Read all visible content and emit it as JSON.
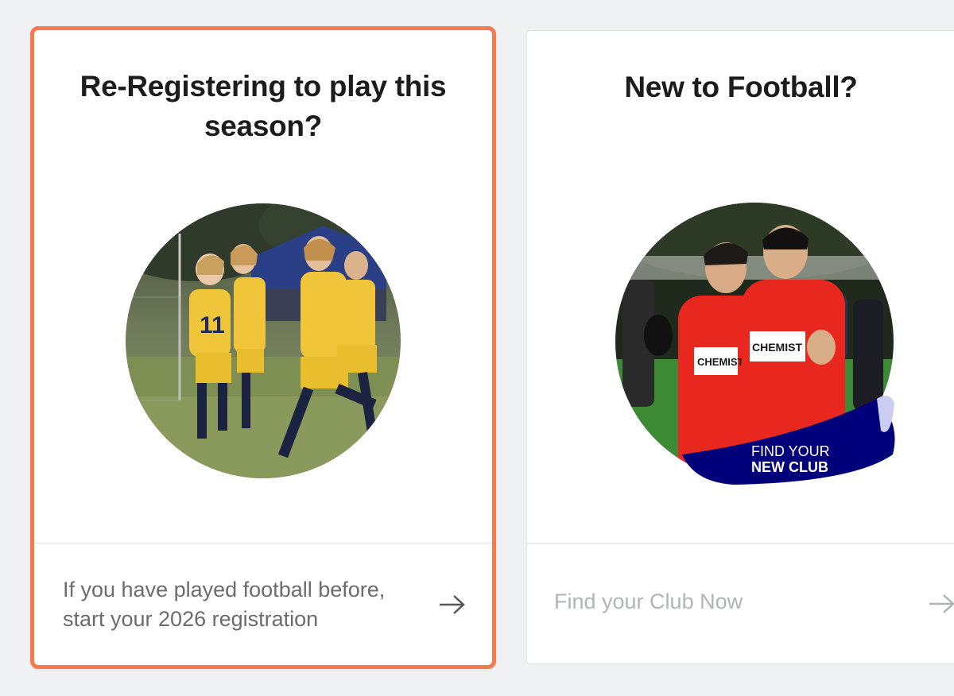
{
  "cards": [
    {
      "title": "Re-Registering to play this season?",
      "description": "If you have played football before, start your 2026 registration",
      "image_alt": "Girls in yellow kits celebrating on a football pitch",
      "arrow_icon": "arrow-right-icon",
      "accent": "#f47b50"
    },
    {
      "title": "New to Football?",
      "description": "Find your Club Now",
      "image_alt": "Two players in red kits with thumbs up",
      "banner_line1": "FIND YOUR",
      "banner_line2": "NEW CLUB",
      "banner_color": "#00007a",
      "arrow_icon": "arrow-right-icon"
    }
  ],
  "colors": {
    "background": "#f0f1f3",
    "selected_border": "#f47b50",
    "kit_yellow": "#f0c53a",
    "kit_red": "#e8281e"
  }
}
